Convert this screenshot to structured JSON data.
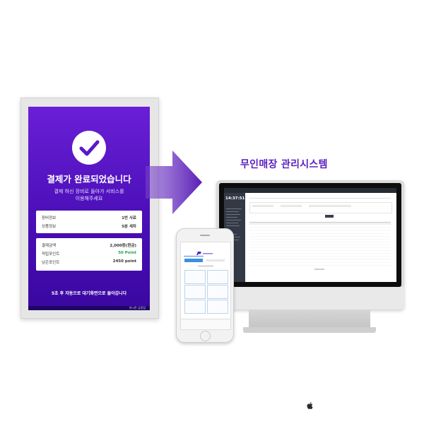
{
  "kiosk": {
    "title": "결제가 완료되었습니다",
    "subtitle_line1": "결제 하신 장비로 돌아가 서비스를",
    "subtitle_line2": "이용해주세요",
    "card1": [
      {
        "label": "장비정보",
        "value": "1번 사료"
      },
      {
        "label": "상품정보",
        "value": "5분 세차"
      }
    ],
    "card2": [
      {
        "label": "결제금액",
        "value": "2,000원(현금)"
      },
      {
        "label": "적립포인트",
        "value": "50 Point"
      },
      {
        "label": "남은포인트",
        "value": "2450 point"
      }
    ],
    "notice": "5초 후 자동으로 대기화면으로 돌아갑니다",
    "footer": "워시존 금정점"
  },
  "headline": "무인매장 관리시스템",
  "monitor": {
    "time": "14:37:51"
  },
  "colors": {
    "brand_purple": "#5b1fbf",
    "kiosk_gradient_top": "#6a1fd6",
    "kiosk_gradient_bottom": "#3a07a0",
    "point_green": "#1ea052"
  }
}
